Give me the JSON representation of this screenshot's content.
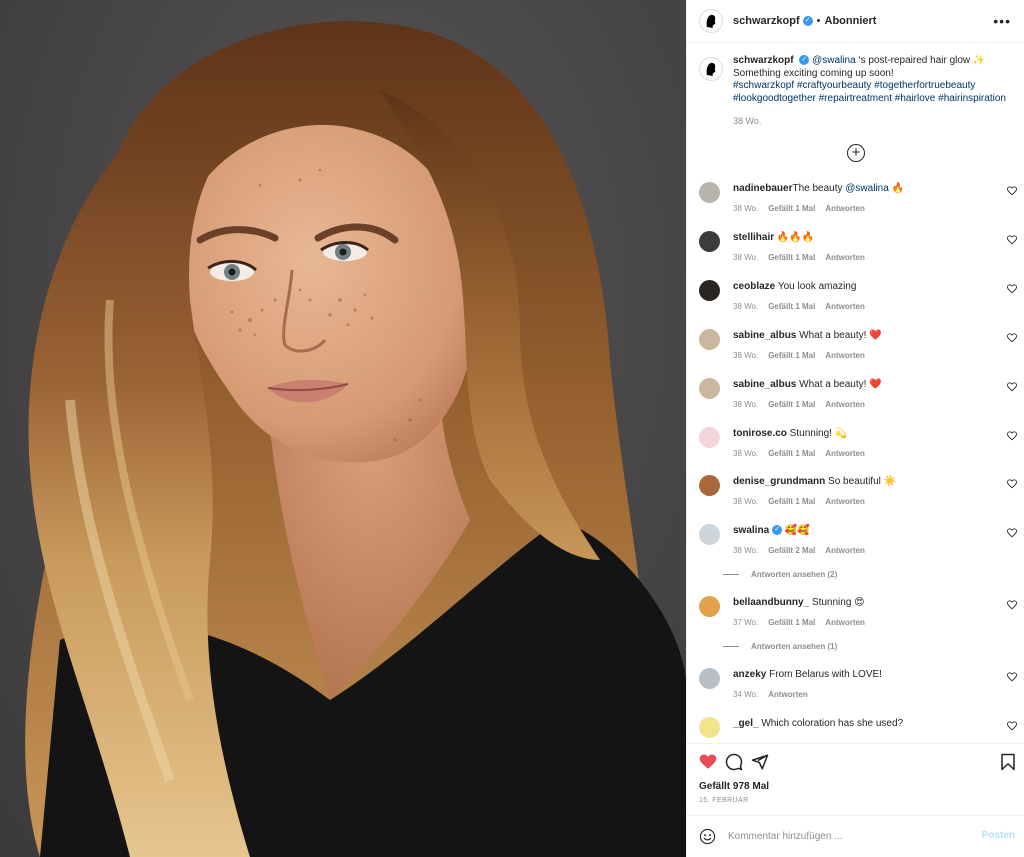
{
  "post": {
    "username": "schwarzkopf",
    "follow_status": "Abonniert",
    "separator": "•",
    "verified_mark": "✓",
    "more_icon": "more-options-icon",
    "caption": {
      "mention": "@swalina",
      "text_1": " ‘s post-repaired hair glow ✨",
      "text_2": "Something exciting coming up soon!",
      "hashtags_1": "#schwarzkopf #craftyourbeauty #togetherfortruebeauty",
      "hashtags_2": "#lookgoodtogether #repairtreatment #hairlove #hairinspiration",
      "time": "38 Wo."
    },
    "load_more_icon": "+",
    "likes_label": "Gefällt 978 Mal",
    "date": "15. FEBRUAR",
    "comment_placeholder": "Kommentar hinzufügen ...",
    "post_button": "Posten"
  },
  "comments": [
    {
      "user": "nadinebauer",
      "text": "The beauty ",
      "mention": "@swalina",
      "emoji": " 🔥",
      "time": "38 Wo.",
      "likes": "Gefällt 1 Mal",
      "reply": "Antworten",
      "avatar_color": "#b9b3ad"
    },
    {
      "user": "stellihair",
      "text": " 🔥🔥🔥",
      "time": "38 Wo.",
      "likes": "Gefällt 1 Mal",
      "reply": "Antworten",
      "avatar_color": "#3c3c3c"
    },
    {
      "user": "ceoblaze",
      "text": " You look amazing",
      "time": "38 Wo.",
      "likes": "Gefällt 1 Mal",
      "reply": "Antworten",
      "avatar_color": "#2a2520"
    },
    {
      "user": "sabine_albus",
      "text": " What a beauty! ❤️",
      "time": "38 Wo.",
      "likes": "Gefällt 1 Mal",
      "reply": "Antworten",
      "avatar_color": "#c9b79f"
    },
    {
      "user": "sabine_albus",
      "text": " What a beauty! ❤️",
      "time": "38 Wo.",
      "likes": "Gefällt 1 Mal",
      "reply": "Antworten",
      "avatar_color": "#c9b79f"
    },
    {
      "user": "tonirose.co",
      "text": " Stunning! 💫",
      "time": "38 Wo.",
      "likes": "Gefällt 1 Mal",
      "reply": "Antworten",
      "avatar_color": "#f3d6dc"
    },
    {
      "user": "denise_grundmann",
      "text": " So beautiful ☀️",
      "time": "38 Wo.",
      "likes": "Gefällt 1 Mal",
      "reply": "Antworten",
      "avatar_color": "#a9683c"
    },
    {
      "user": "swalina",
      "verified": "✓",
      "text": " 🥰🥰",
      "time": "38 Wo.",
      "likes": "Gefällt 2 Mal",
      "reply": "Antworten",
      "avatar_color": "#cdd5da",
      "view_replies": "Antworten ansehen (2)"
    },
    {
      "user": "bellaandbunny_",
      "text": " Stunning 😍",
      "time": "37 Wo.",
      "likes": "Gefällt 1 Mal",
      "reply": "Antworten",
      "avatar_color": "#e2a24a",
      "view_replies": "Antworten ansehen (1)"
    },
    {
      "user": "anzeky",
      "text": " From Belarus with LOVE!",
      "time": "34 Wo.",
      "reply": "Antworten",
      "avatar_color": "#b6bfc6"
    },
    {
      "user": "_gel_",
      "text": "  Which coloration has she used?",
      "avatar_color": "#f3e38a"
    }
  ],
  "icons": {
    "like": "heart-filled-icon",
    "comment": "comment-bubble-icon",
    "share": "paper-plane-icon",
    "save": "bookmark-icon",
    "emoji": "smiley-icon"
  },
  "colors": {
    "like_red": "#ed4956",
    "link_blue": "#003569",
    "verified_blue": "#3897f0",
    "muted_gray": "#8e8e8e",
    "post_disabled": "#b2dffc"
  }
}
